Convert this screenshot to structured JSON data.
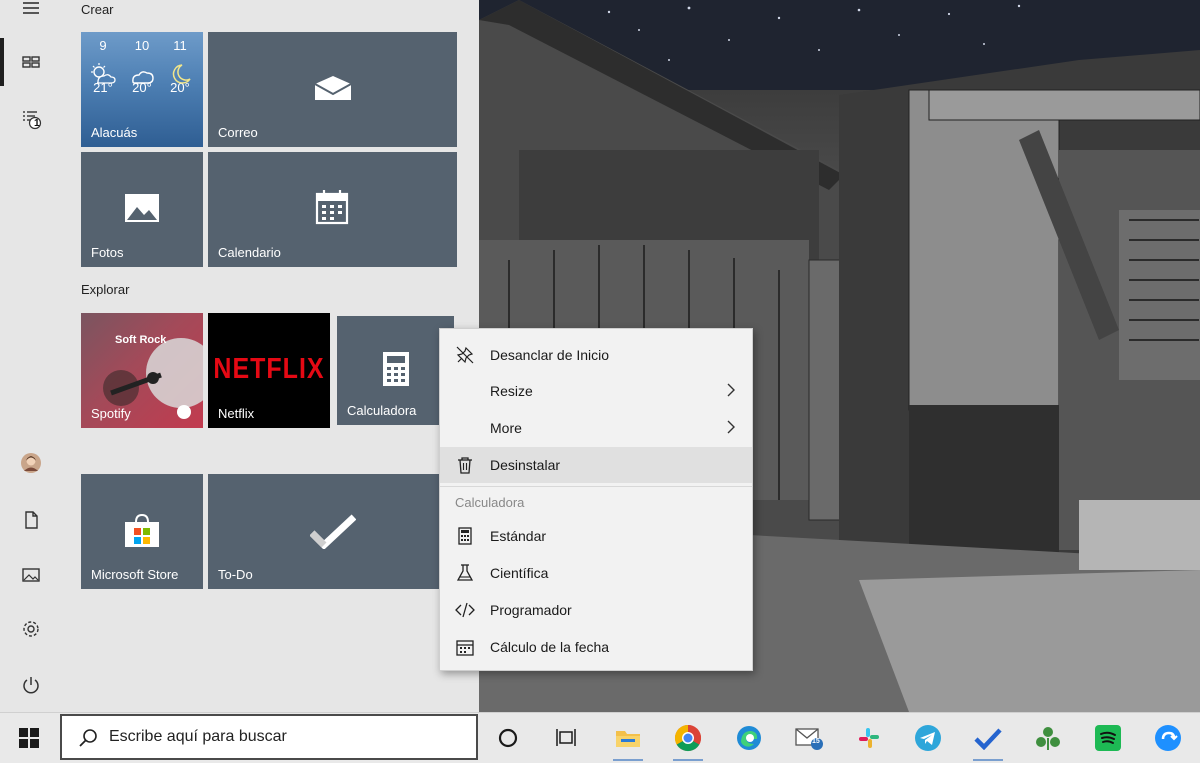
{
  "start_menu": {
    "groups": [
      {
        "label": "Crear"
      },
      {
        "label": "Explorar"
      }
    ],
    "weather": {
      "location": "Alacuás",
      "days": [
        {
          "day": "9",
          "temp": "21°",
          "icon": "partly-sunny-icon"
        },
        {
          "day": "10",
          "temp": "20°",
          "icon": "cloudy-icon"
        },
        {
          "day": "11",
          "temp": "20°",
          "icon": "moon-icon"
        }
      ]
    },
    "tiles": {
      "mail": "Correo",
      "photos": "Fotos",
      "calendar": "Calendario",
      "spotify": "Spotify",
      "spotify_art": "Soft Rock",
      "netflix": "Netflix",
      "netflix_logo": "NETFLIX",
      "calculator": "Calculadora",
      "store": "Microsoft Store",
      "todo": "To-Do"
    },
    "rail": {
      "badge": "1"
    }
  },
  "context_menu": {
    "items": [
      {
        "label": "Desanclar de Inicio",
        "icon": "unpin-icon"
      },
      {
        "label": "Resize",
        "icon": "chevron-right-icon"
      },
      {
        "label": "More",
        "icon": "chevron-right-icon"
      },
      {
        "label": "Desinstalar",
        "icon": "trash-icon"
      }
    ],
    "section_title": "Calculadora",
    "jump_list": [
      {
        "label": "Estándar",
        "icon": "calculator-icon"
      },
      {
        "label": "Científica",
        "icon": "flask-icon"
      },
      {
        "label": "Programador",
        "icon": "code-icon"
      },
      {
        "label": "Cálculo de la fecha",
        "icon": "calendar-icon"
      }
    ]
  },
  "taskbar": {
    "search_placeholder": "Escribe aquí para buscar",
    "mail_badge": "15",
    "apps": [
      "cortana-icon",
      "task-view-icon",
      "file-explorer-icon",
      "chrome-icon",
      "edge-icon",
      "mail-icon",
      "slack-icon",
      "telegram-icon",
      "todo-icon",
      "app-icon",
      "spotify-icon",
      "app-icon"
    ]
  },
  "colors": {
    "tile": "#55626f",
    "start_bg": "#e6e6e6",
    "netflix_red": "#e50914",
    "spotify_green": "#1db954"
  }
}
